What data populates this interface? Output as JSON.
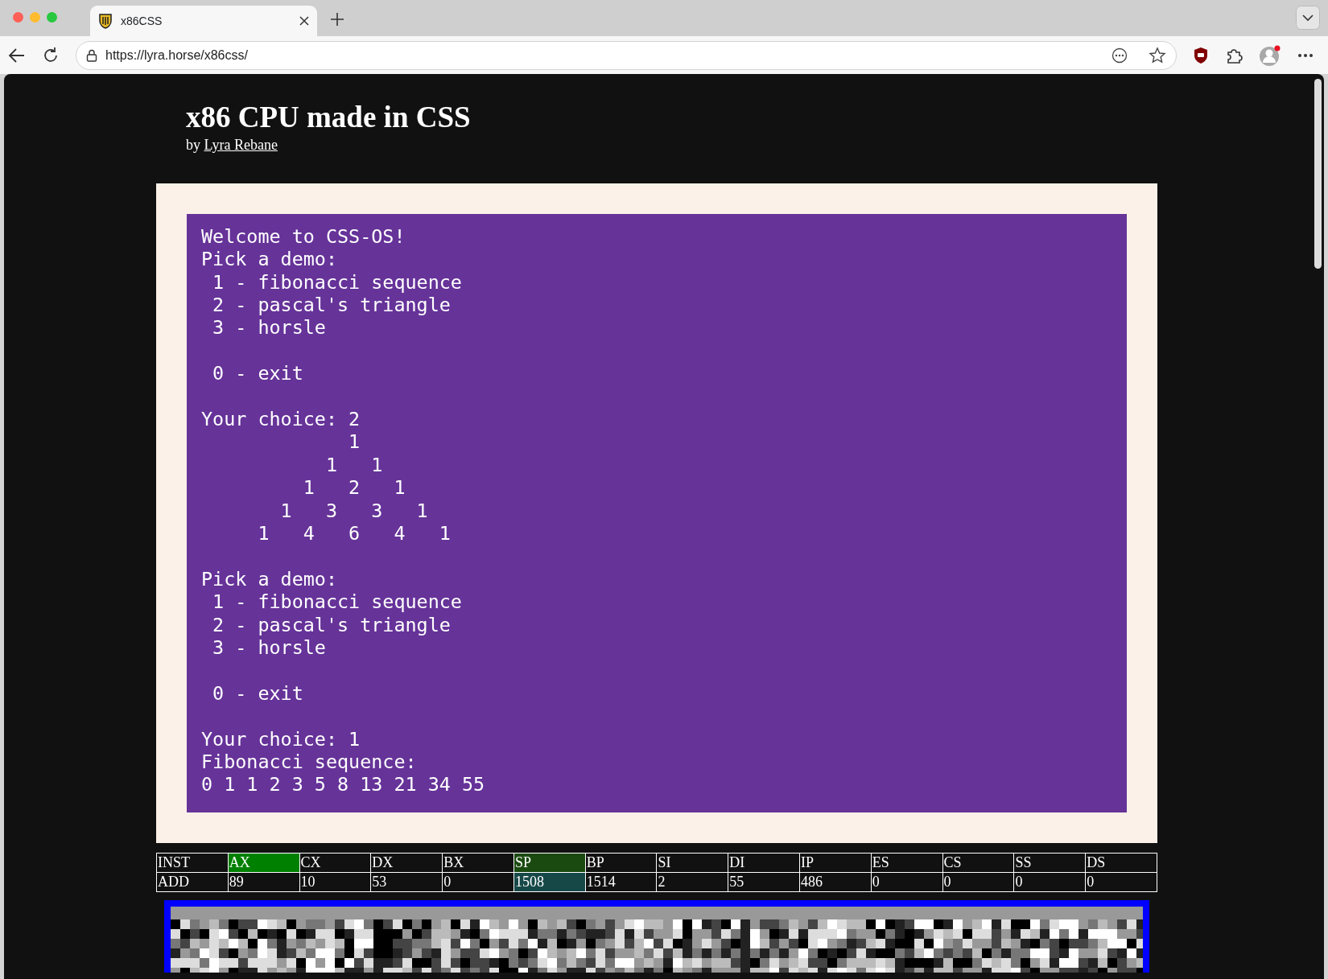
{
  "browser": {
    "tab_title": "x86CSS",
    "url": "https://lyra.horse/x86css/"
  },
  "page": {
    "title": "x86 CPU made in CSS",
    "byline": "by",
    "author_link": "Lyra Rebane"
  },
  "terminal": {
    "output": "Welcome to CSS-OS!\nPick a demo:\n 1 - fibonacci sequence\n 2 - pascal's triangle\n 3 - horsle\n\n 0 - exit\n\nYour choice: 2\n             1\n           1   1\n         1   2   1\n       1   3   3   1\n     1   4   6   4   1\n\nPick a demo:\n 1 - fibonacci sequence\n 2 - pascal's triangle\n 3 - horsle\n\n 0 - exit\n\nYour choice: 1\nFibonacci sequence:\n0 1 1 2 3 5 8 13 21 34 55"
  },
  "registers": [
    {
      "name": "INST",
      "value": "ADD",
      "kind": "plain"
    },
    {
      "name": "AX",
      "value": "89",
      "kind": "written"
    },
    {
      "name": "CX",
      "value": "10",
      "kind": "plain"
    },
    {
      "name": "DX",
      "value": "53",
      "kind": "plain"
    },
    {
      "name": "BX",
      "value": "0",
      "kind": "plain"
    },
    {
      "name": "SP",
      "value": "1508",
      "kind": "stack"
    },
    {
      "name": "BP",
      "value": "1514",
      "kind": "plain"
    },
    {
      "name": "SI",
      "value": "2",
      "kind": "plain"
    },
    {
      "name": "DI",
      "value": "55",
      "kind": "plain"
    },
    {
      "name": "IP",
      "value": "486",
      "kind": "plain"
    },
    {
      "name": "ES",
      "value": "0",
      "kind": "plain"
    },
    {
      "name": "CS",
      "value": "0",
      "kind": "plain"
    },
    {
      "name": "SS",
      "value": "0",
      "kind": "plain"
    },
    {
      "name": "DS",
      "value": "0",
      "kind": "plain"
    }
  ]
}
